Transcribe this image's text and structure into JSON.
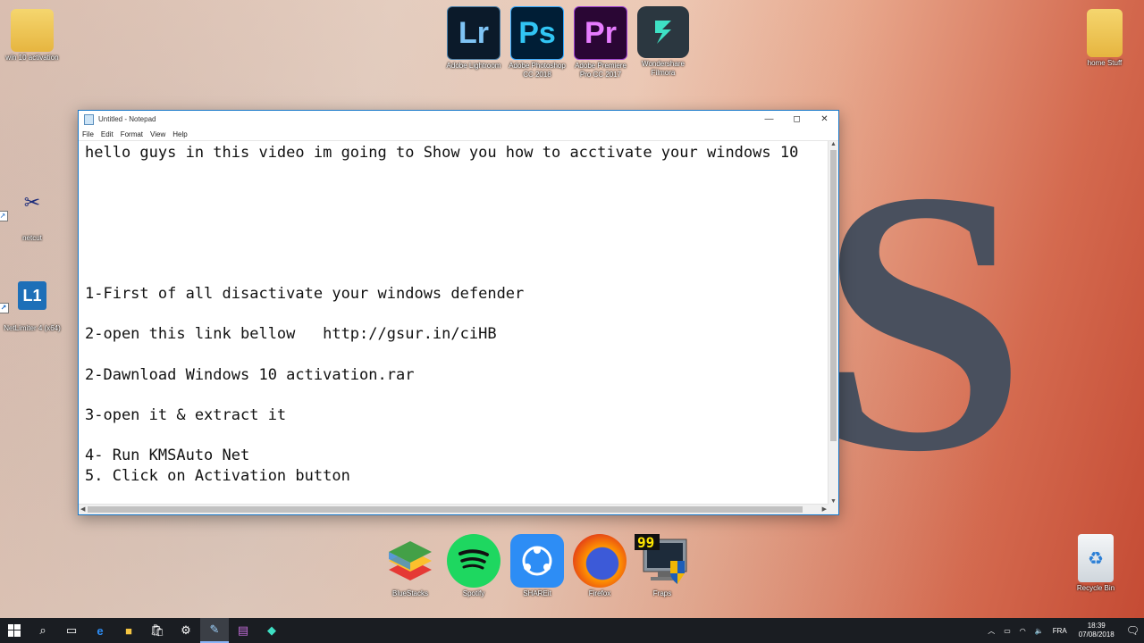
{
  "desktop": {
    "icons_top": [
      {
        "label": "Adobe Lightroom",
        "text": "Lr",
        "fg": "#7fc4f5",
        "bg": "#0b1a2a"
      },
      {
        "label": "Adobe Photoshop CC 2018",
        "text": "Ps",
        "fg": "#31c5f4",
        "bg": "#001e36"
      },
      {
        "label": "Adobe Premiere Pro CC 2017",
        "text": "Pr",
        "fg": "#e77cff",
        "bg": "#2a0634"
      },
      {
        "label": "Wondershare Filmora",
        "text": "",
        "fg": "#3ee0c4",
        "bg": "#2b3740"
      }
    ],
    "left_icons": [
      {
        "label": "win 10 activation"
      },
      {
        "label": "netcut"
      },
      {
        "label": "NetLimiter 4 (x64)"
      }
    ],
    "right_icons": [
      {
        "label": "home Stuff"
      },
      {
        "label": "Recycle Bin"
      }
    ],
    "bottom_icons": [
      {
        "label": "BlueStacks"
      },
      {
        "label": "Spotify"
      },
      {
        "label": "SHAREit"
      },
      {
        "label": "Firefox"
      },
      {
        "label": "Fraps"
      }
    ]
  },
  "notepad": {
    "title": "Untitled - Notepad",
    "menu": [
      "File",
      "Edit",
      "Format",
      "View",
      "Help"
    ],
    "lines": [
      "hello guys in this video im going to Show you how to acctivate your windows 10",
      "",
      "",
      "",
      "",
      "",
      "",
      "1-First of all disactivate your windows defender",
      "",
      "2-open this link bellow   http://gsur.in/ciHB",
      "",
      "2-Dawnload Windows 10 activation.rar",
      "",
      "3-open it & extract it",
      "",
      "4- Run KMSAuto Net",
      "5. Click on Activation button"
    ]
  },
  "taskbar": {
    "lang": "FRA",
    "time": "18:39",
    "date": "07/08/2018"
  }
}
